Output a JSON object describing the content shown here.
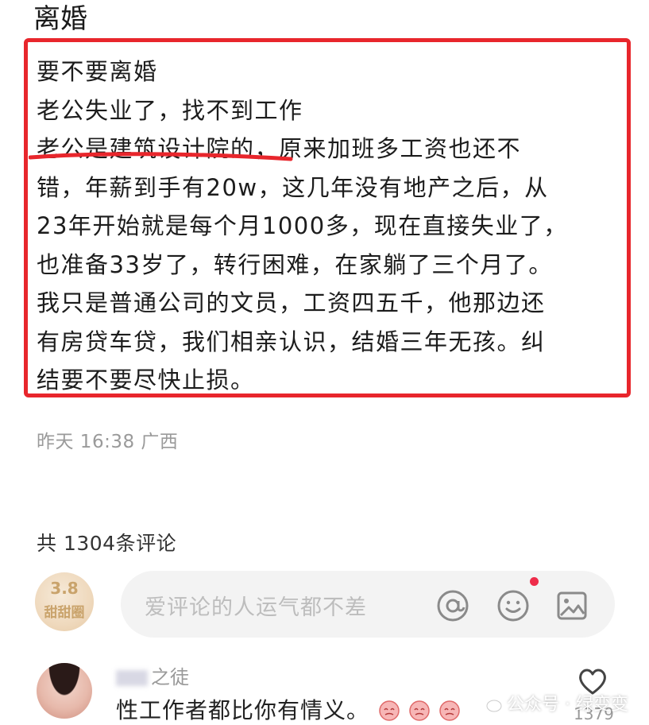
{
  "post": {
    "title": "离婚",
    "lines": [
      "要不要离婚",
      "老公失业了，找不到工作",
      "老公是建筑设计院的，原来加班多工资也还不",
      "错，年薪到手有20w，这几年没有地产之后，从",
      "23年开始就是每个月1000多，现在直接失业了，",
      "也准备33岁了，转行困难，在家躺了三个月了。",
      "我只是普通公司的文员，工资四五千，他那边还",
      "有房贷车贷，我们相亲认识，结婚三年无孩。纠",
      "结要不要尽快止损。"
    ],
    "meta": "昨天 16:38 广西",
    "highlight_color": "#e8262c"
  },
  "comments": {
    "count_label": "共 1304条评论",
    "input_placeholder": "爱评论的人运气都不差",
    "my_avatar_text": [
      "3.8",
      "甜甜圈"
    ],
    "items": [
      {
        "name": "之徒",
        "text": "性工作者都比你有情义。",
        "likes": "1379"
      }
    ]
  },
  "watermark": "公众号 · 绿变变",
  "icons": {
    "mention": "at-sign-icon",
    "emoji": "smiley-icon",
    "image": "image-icon",
    "like": "heart-icon"
  }
}
